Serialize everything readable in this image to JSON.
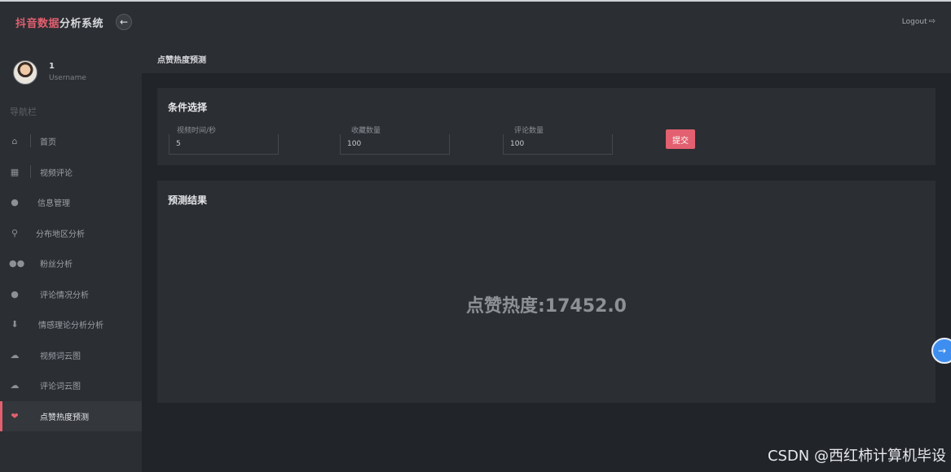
{
  "header": {
    "brand_part1": "抖音数据",
    "brand_part2": "分析系统",
    "collapse_icon": "arrow-left-icon",
    "logout_label": "Logout"
  },
  "user": {
    "id": "1",
    "role": "Username"
  },
  "sidebar": {
    "title": "导航栏",
    "items": [
      {
        "label": "首页",
        "icon": "home-icon"
      },
      {
        "label": "视频评论",
        "icon": "grid-icon"
      },
      {
        "label": "信息管理",
        "icon": "user-icon"
      },
      {
        "label": "分布地区分析",
        "icon": "map-pin-icon"
      },
      {
        "label": "粉丝分析",
        "icon": "users-icon"
      },
      {
        "label": "评论情况分析",
        "icon": "comment-icon"
      },
      {
        "label": "情感理论分析分析",
        "icon": "flask-icon"
      },
      {
        "label": "视频词云图",
        "icon": "cloud-upload-icon"
      },
      {
        "label": "评论词云图",
        "icon": "cloud-upload-icon"
      },
      {
        "label": "点赞热度预测",
        "icon": "heart-icon",
        "active": true
      }
    ]
  },
  "page": {
    "title": "点赞热度预测"
  },
  "conditions": {
    "title": "条件选择",
    "fields": [
      {
        "label": "视频时间/秒",
        "value": "5"
      },
      {
        "label": "收藏数量",
        "value": "100"
      },
      {
        "label": "评论数量",
        "value": "100"
      }
    ],
    "submit_label": "提交"
  },
  "result": {
    "title": "预测结果",
    "text": "点赞热度:17452.0"
  },
  "watermark": "CSDN @西红柿计算机毕设",
  "colors": {
    "accent": "#e2606f",
    "background": "#212429",
    "panel": "#2b2e33"
  }
}
